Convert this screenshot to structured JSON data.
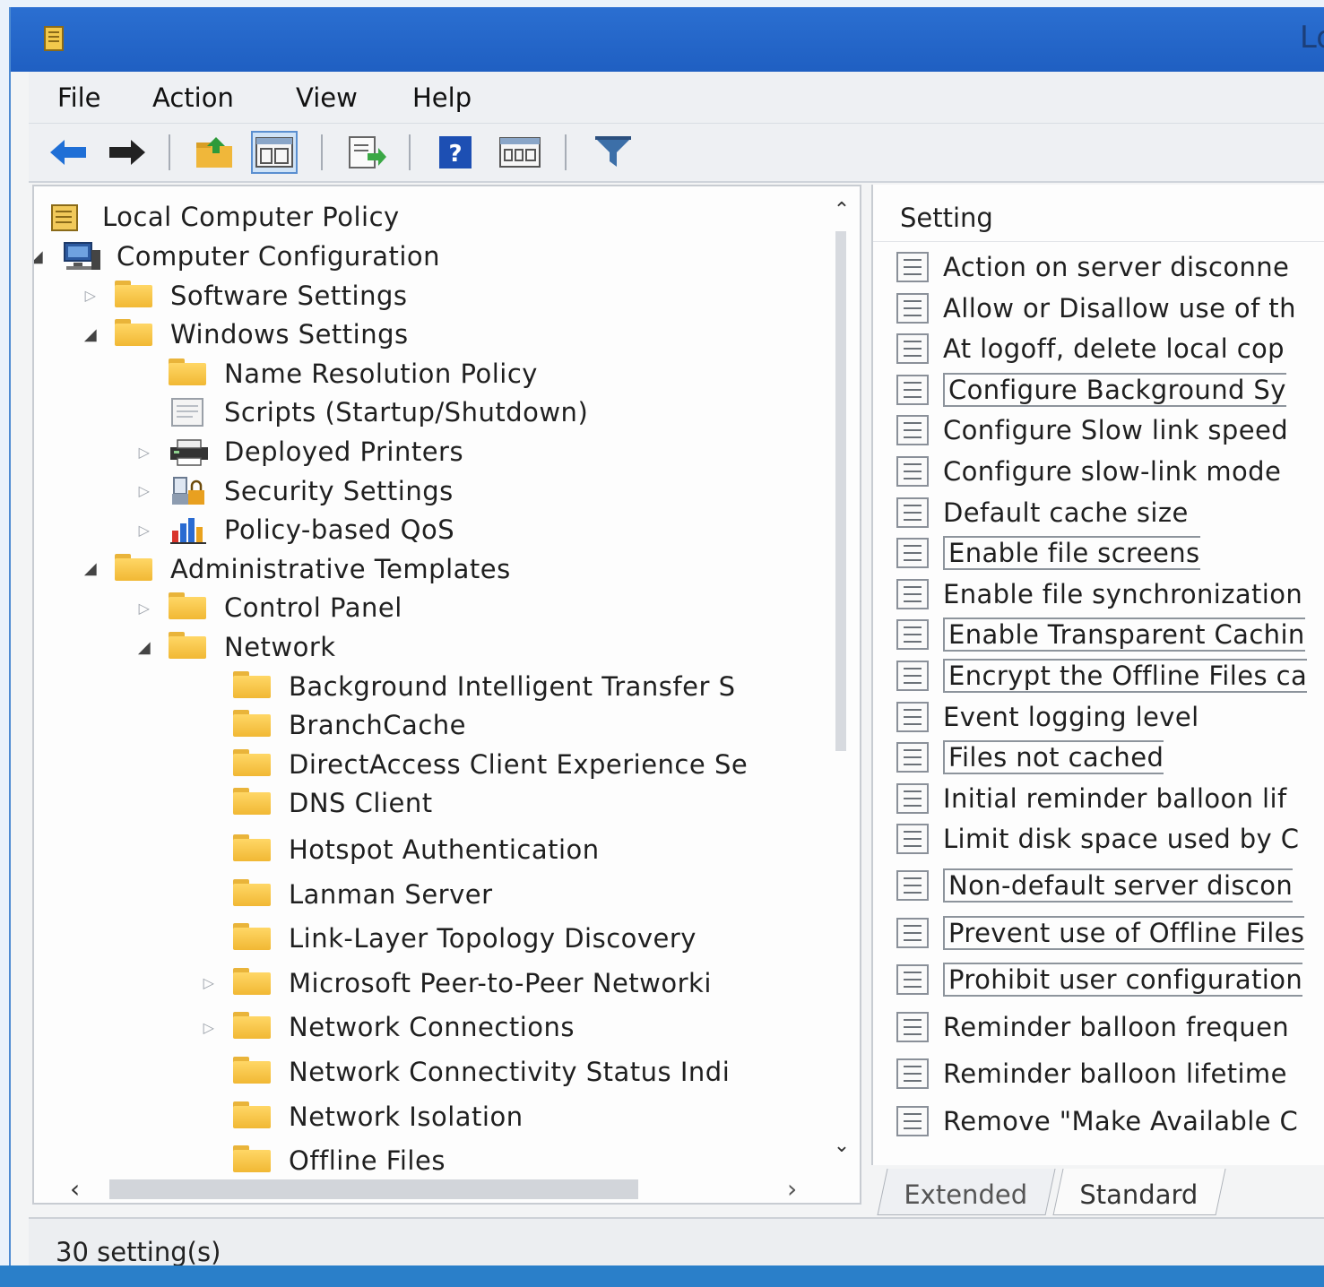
{
  "window": {
    "title": "Lo"
  },
  "menu": [
    "File",
    "Action",
    "View",
    "Help"
  ],
  "toolbar": {
    "icons": [
      "back-arrow-icon",
      "forward-arrow-icon",
      "up-folder-icon",
      "show-hide-tree-icon",
      "export-list-icon",
      "help-icon",
      "properties-icon",
      "filter-icon"
    ]
  },
  "tree": {
    "root": "Local Computer Policy",
    "items": [
      {
        "label": "Computer Configuration",
        "level": 1,
        "state": "expanded",
        "icon": "computer-icon"
      },
      {
        "label": "Software Settings",
        "level": 2,
        "state": "collapsed",
        "icon": "folder-icon"
      },
      {
        "label": "Windows Settings",
        "level": 2,
        "state": "expanded",
        "icon": "folder-icon"
      },
      {
        "label": "Name Resolution Policy",
        "level": 3,
        "state": "none",
        "icon": "folder-icon"
      },
      {
        "label": "Scripts (Startup/Shutdown)",
        "level": 3,
        "state": "none",
        "icon": "scripts-icon"
      },
      {
        "label": "Deployed Printers",
        "level": 3,
        "state": "collapsed",
        "icon": "printer-icon"
      },
      {
        "label": "Security Settings",
        "level": 3,
        "state": "collapsed",
        "icon": "security-icon"
      },
      {
        "label": "Policy-based QoS",
        "level": 3,
        "state": "collapsed",
        "icon": "qos-chart-icon"
      },
      {
        "label": "Administrative Templates",
        "level": 2,
        "state": "expanded",
        "icon": "folder-icon"
      },
      {
        "label": "Control Panel",
        "level": 3,
        "state": "collapsed",
        "icon": "folder-icon"
      },
      {
        "label": "Network",
        "level": 3,
        "state": "expanded",
        "icon": "folder-icon"
      },
      {
        "label": "Background Intelligent Transfer S",
        "level": 4,
        "state": "none",
        "icon": "folder-icon"
      },
      {
        "label": "BranchCache",
        "level": 4,
        "state": "none",
        "icon": "folder-icon"
      },
      {
        "label": "DirectAccess Client Experience Se",
        "level": 4,
        "state": "none",
        "icon": "folder-icon"
      },
      {
        "label": "DNS Client",
        "level": 4,
        "state": "none",
        "icon": "folder-icon"
      },
      {
        "label": "Hotspot Authentication",
        "level": 4,
        "state": "none",
        "icon": "folder-icon"
      },
      {
        "label": "Lanman Server",
        "level": 4,
        "state": "none",
        "icon": "folder-icon"
      },
      {
        "label": "Link-Layer Topology Discovery",
        "level": 4,
        "state": "none",
        "icon": "folder-icon"
      },
      {
        "label": "Microsoft Peer-to-Peer Networki",
        "level": 4,
        "state": "collapsed",
        "icon": "folder-icon"
      },
      {
        "label": "Network Connections",
        "level": 4,
        "state": "collapsed",
        "icon": "folder-icon"
      },
      {
        "label": "Network Connectivity Status Indi",
        "level": 4,
        "state": "none",
        "icon": "folder-icon"
      },
      {
        "label": "Network Isolation",
        "level": 4,
        "state": "none",
        "icon": "folder-icon"
      },
      {
        "label": "Offline Files",
        "level": 4,
        "state": "none",
        "icon": "folder-icon"
      }
    ]
  },
  "settings": {
    "header": "Setting",
    "items": [
      {
        "label": "Action on server disconne",
        "boxed": false
      },
      {
        "label": "Allow or Disallow use of th",
        "boxed": false
      },
      {
        "label": "At logoff, delete local cop",
        "boxed": false
      },
      {
        "label": "Configure Background Sy",
        "boxed": true
      },
      {
        "label": "Configure Slow link speed",
        "boxed": false
      },
      {
        "label": "Configure slow-link mode",
        "boxed": false
      },
      {
        "label": "Default cache size",
        "boxed": false
      },
      {
        "label": "Enable file screens",
        "boxed": true
      },
      {
        "label": "Enable file synchronization",
        "boxed": false
      },
      {
        "label": "Enable Transparent Cachin",
        "boxed": true
      },
      {
        "label": "Encrypt the Offline Files ca",
        "boxed": true
      },
      {
        "label": "Event logging level",
        "boxed": false
      },
      {
        "label": "Files not cached",
        "boxed": true
      },
      {
        "label": "Initial reminder balloon lif",
        "boxed": false
      },
      {
        "label": "Limit disk space used by C",
        "boxed": false
      },
      {
        "label": "Non-default server discon",
        "boxed": true
      },
      {
        "label": "Prevent use of Offline Files",
        "boxed": true
      },
      {
        "label": "Prohibit user configuration",
        "boxed": true
      },
      {
        "label": "Reminder balloon frequen",
        "boxed": false
      },
      {
        "label": "Reminder balloon lifetime",
        "boxed": false
      },
      {
        "label": "Remove \"Make Available C",
        "boxed": false
      }
    ]
  },
  "tabs": [
    {
      "label": "Extended",
      "active": false
    },
    {
      "label": "Standard",
      "active": true
    }
  ],
  "status": {
    "text": "30 setting(s)"
  }
}
